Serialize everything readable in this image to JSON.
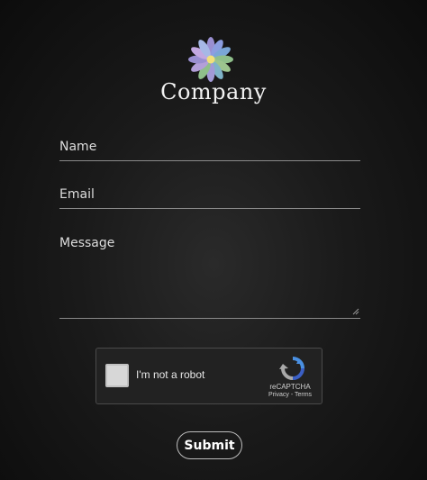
{
  "brand": {
    "name": "Company",
    "logo_icon": "flower-logo-icon"
  },
  "form": {
    "name_label": "Name",
    "email_label": "Email",
    "message_label": "Message",
    "submit_label": "Submit"
  },
  "recaptcha": {
    "checkbox_label": "I'm not a robot",
    "brand": "reCAPTCHA",
    "links": "Privacy - Terms",
    "logo_icon": "recaptcha-icon"
  },
  "colors": {
    "background": "#1a1a1a",
    "text": "#e6e6e6",
    "underline": "#8a8a8a",
    "petal_purple": "#9a8fd1",
    "petal_blue": "#7aa6d6",
    "petal_green": "#8fbf8a",
    "center_yellow": "#f2e07a"
  }
}
